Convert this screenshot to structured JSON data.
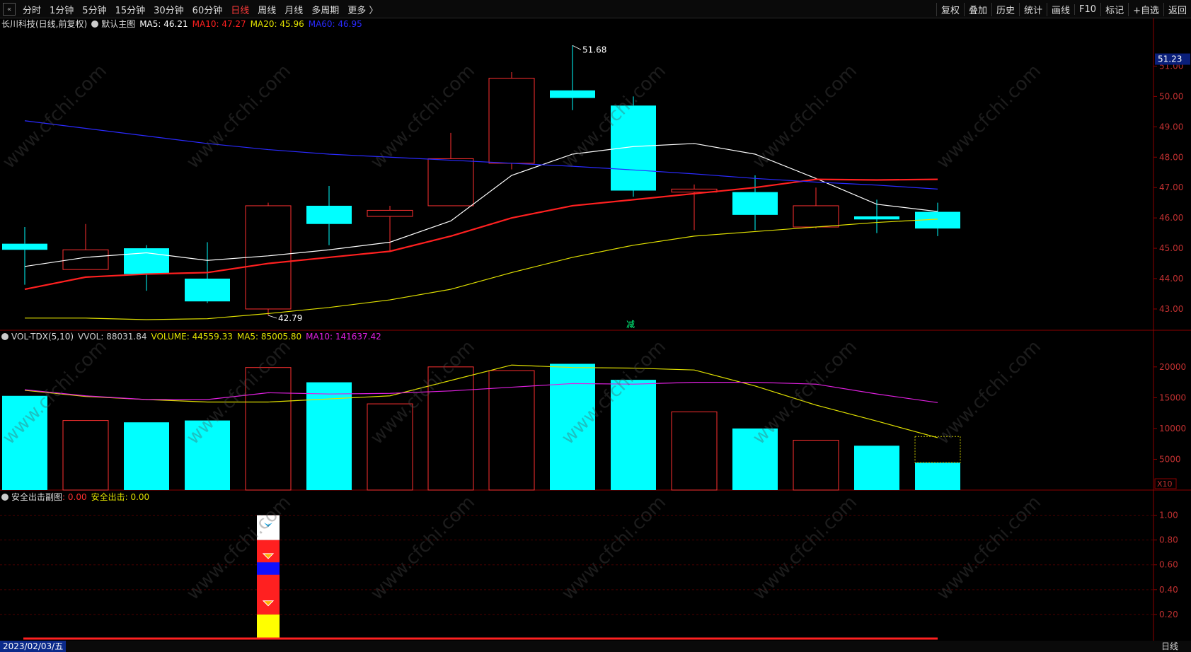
{
  "toolbar": {
    "periods": [
      "分时",
      "1分钟",
      "5分钟",
      "15分钟",
      "30分钟",
      "60分钟",
      "日线",
      "周线",
      "月线",
      "多周期",
      "更多 〉"
    ],
    "active_period": "日线",
    "tools": [
      "复权",
      "叠加",
      "历史",
      "统计",
      "画线",
      "F10",
      "标记",
      "+自选",
      "返回"
    ]
  },
  "main_panel": {
    "title": "长川科技(日线,前复权)",
    "subtitle": "默认主图",
    "ma_labels": [
      {
        "text": "MA5: 46.21",
        "color": "#ffffff"
      },
      {
        "text": "MA10: 47.27",
        "color": "#ff2020"
      },
      {
        "text": "MA20: 45.96",
        "color": "#e0e000"
      },
      {
        "text": "MA60: 46.95",
        "color": "#2a2aff"
      }
    ],
    "price_axis": [
      "51.00",
      "50.00",
      "49.00",
      "48.00",
      "47.00",
      "46.00",
      "45.00",
      "44.00",
      "43.00"
    ],
    "last_price": "51.23",
    "high_label": "51.68",
    "low_label": "42.79",
    "marker": "减"
  },
  "vol_panel": {
    "title": "VOL-TDX(5,10)",
    "labels": [
      {
        "text": "VVOL: 88031.84",
        "color": "#cccccc"
      },
      {
        "text": "VOLUME: 44559.33",
        "color": "#e0e000"
      },
      {
        "text": "MA5: 85005.80",
        "color": "#e0e000"
      },
      {
        "text": "MA10: 141637.42",
        "color": "#e020e0"
      }
    ],
    "axis": [
      "20000",
      "15000",
      "10000",
      "5000"
    ],
    "unit": "X10"
  },
  "sub_panel": {
    "title": "安全出击副图",
    "labels": [
      {
        "text": ": 0.00",
        "color": "#ff3030"
      },
      {
        "text": "安全出击: 0.00",
        "color": "#e0e000"
      }
    ],
    "axis": [
      "1.00",
      "0.80",
      "0.60",
      "0.40",
      "0.20"
    ]
  },
  "footer": {
    "date": "2023/02/03/五",
    "period": "日线"
  },
  "watermark": "www.cfchi.com",
  "colors": {
    "up": "#ff3030",
    "down": "#00ffff",
    "ma5": "#ffffff",
    "ma10": "#ff2020",
    "ma20": "#e0e000",
    "ma60": "#2a2aff",
    "vma10": "#e020e0"
  },
  "chart_data": [
    {
      "type": "candlestick",
      "title": "长川科技(日线,前复权)",
      "ylim": [
        42.3,
        51.5
      ],
      "candles": [
        {
          "open": 45.15,
          "high": 45.7,
          "low": 43.8,
          "close": 44.95
        },
        {
          "open": 44.3,
          "high": 45.8,
          "low": 44.3,
          "close": 44.95
        },
        {
          "open": 45.0,
          "high": 45.1,
          "low": 43.6,
          "close": 44.15
        },
        {
          "open": 44.0,
          "high": 45.2,
          "low": 43.2,
          "close": 43.25
        },
        {
          "open": 43.0,
          "high": 46.5,
          "low": 42.79,
          "close": 46.4
        },
        {
          "open": 46.4,
          "high": 47.05,
          "low": 45.1,
          "close": 45.8
        },
        {
          "open": 46.05,
          "high": 46.4,
          "low": 44.9,
          "close": 46.25
        },
        {
          "open": 46.4,
          "high": 48.8,
          "low": 46.4,
          "close": 47.95
        },
        {
          "open": 47.8,
          "high": 50.8,
          "low": 47.6,
          "close": 50.6
        },
        {
          "open": 50.2,
          "high": 51.68,
          "low": 49.55,
          "close": 49.95
        },
        {
          "open": 49.7,
          "high": 50.0,
          "low": 46.7,
          "close": 46.9
        },
        {
          "open": 46.85,
          "high": 47.1,
          "low": 45.6,
          "close": 46.95
        },
        {
          "open": 46.85,
          "high": 47.4,
          "low": 45.6,
          "close": 46.1
        },
        {
          "open": 45.7,
          "high": 47.0,
          "low": 45.65,
          "close": 46.4
        },
        {
          "open": 46.05,
          "high": 46.6,
          "low": 45.5,
          "close": 45.95
        },
        {
          "open": 46.2,
          "high": 46.5,
          "low": 45.4,
          "close": 45.65
        }
      ],
      "series": [
        {
          "name": "MA5",
          "values": [
            44.4,
            44.7,
            44.85,
            44.6,
            44.75,
            44.95,
            45.2,
            45.9,
            47.4,
            48.1,
            48.35,
            48.45,
            48.1,
            47.3,
            46.45,
            46.21
          ]
        },
        {
          "name": "MA10",
          "values": [
            43.65,
            44.05,
            44.15,
            44.2,
            44.5,
            44.7,
            44.9,
            45.4,
            46.0,
            46.4,
            46.6,
            46.8,
            47.0,
            47.27,
            47.25,
            47.27
          ]
        },
        {
          "name": "MA20",
          "values": [
            42.7,
            42.7,
            42.65,
            42.68,
            42.85,
            43.05,
            43.3,
            43.65,
            44.2,
            44.7,
            45.1,
            45.4,
            45.55,
            45.7,
            45.85,
            45.96
          ]
        },
        {
          "name": "MA60",
          "values": [
            49.2,
            48.95,
            48.7,
            48.45,
            48.25,
            48.1,
            48.0,
            47.9,
            47.8,
            47.7,
            47.58,
            47.45,
            47.3,
            47.18,
            47.08,
            46.95
          ]
        }
      ]
    },
    {
      "type": "bar",
      "title": "VOL-TDX(5,10)",
      "ylim": [
        0,
        24000
      ],
      "values": [
        15300,
        11300,
        11000,
        11300,
        19900,
        17500,
        14000,
        20000,
        19400,
        20500,
        17900,
        12700,
        10000,
        8100,
        7200,
        4450
      ],
      "up": [
        false,
        true,
        false,
        false,
        true,
        false,
        true,
        true,
        true,
        false,
        false,
        true,
        false,
        true,
        false,
        false
      ],
      "series": [
        {
          "name": "MA5",
          "values": [
            16200,
            15200,
            14700,
            14300,
            14300,
            14800,
            15300,
            17800,
            20300,
            19900,
            19800,
            19500,
            16900,
            13800,
            11200,
            8500
          ]
        },
        {
          "name": "MA10",
          "values": [
            16300,
            15300,
            14700,
            14700,
            15800,
            15600,
            15700,
            16100,
            16700,
            17300,
            17200,
            17500,
            17500,
            17200,
            15600,
            14200
          ]
        }
      ]
    },
    {
      "type": "bar",
      "title": "安全出击副图",
      "ylim": [
        0,
        1.1
      ],
      "signal_index": 4,
      "segments": [
        {
          "from": 0.0,
          "to": 0.2,
          "color": "#ffff00"
        },
        {
          "from": 0.2,
          "to": 0.8,
          "color": "#ff2020"
        },
        {
          "from": 0.52,
          "to": 0.62,
          "color": "#1010ff"
        },
        {
          "from": 0.8,
          "to": 1.0,
          "color": "#ffffff"
        }
      ]
    }
  ]
}
